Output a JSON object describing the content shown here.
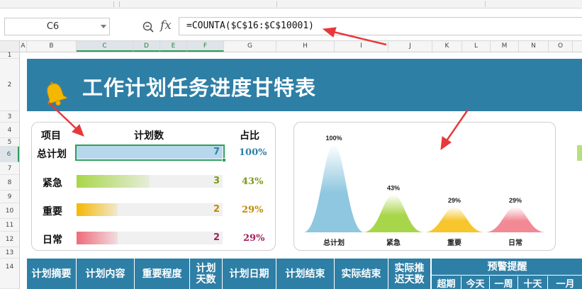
{
  "formula_bar": {
    "cell_ref": "C6",
    "fx_label": "fx",
    "formula": "=COUNTA($C$16:$C$10001)"
  },
  "columns": [
    "A",
    "B",
    "C",
    "D",
    "E",
    "F",
    "G",
    "H",
    "I",
    "J",
    "K",
    "L",
    "M",
    "N",
    "O"
  ],
  "rows": [
    "1",
    "2",
    "3",
    "4",
    "5",
    "6",
    "7",
    "8",
    "9",
    "10",
    "11",
    "12",
    "13",
    "14"
  ],
  "selected": {
    "column": "C",
    "row": "6"
  },
  "banner": {
    "title": "工作计划任务进度甘特表",
    "bg_color": "#2e7fa6",
    "icon": "bell-icon"
  },
  "summary": {
    "headers": {
      "item": "项目",
      "count": "计划数",
      "ratio": "占比"
    },
    "rows": [
      {
        "label": "总计划",
        "count": "7",
        "pct": "100%",
        "fill": 1.0,
        "color": "#b6d8ea",
        "text_color": "#2e7fa6"
      },
      {
        "label": "紧急",
        "count": "3",
        "pct": "43%",
        "fill": 0.5,
        "color": "#a8d64a",
        "text_color": "#7a9a16"
      },
      {
        "label": "重要",
        "count": "2",
        "pct": "29%",
        "fill": 0.28,
        "color": "#f5b800",
        "text_color": "#c08a00"
      },
      {
        "label": "日常",
        "count": "2",
        "pct": "29%",
        "fill": 0.28,
        "color": "#f06a7a",
        "text_color": "#a0205a"
      }
    ]
  },
  "chart_data": {
    "type": "area",
    "categories": [
      "总计划",
      "紧急",
      "重要",
      "日常"
    ],
    "values": [
      100,
      43,
      29,
      29
    ],
    "data_labels": [
      "100%",
      "43%",
      "29%",
      "29%"
    ],
    "colors": [
      "#8ec7df",
      "#a8d64a",
      "#f7c52c",
      "#f28a96"
    ],
    "ylim": [
      0,
      100
    ]
  },
  "table_header": {
    "columns": [
      "计划摘要",
      "计划内容",
      "重要程度",
      "计划天数",
      "计划日期",
      "计划结束",
      "实际结束",
      "实际推迟天数"
    ],
    "warning_group": "预警提醒",
    "warning_sub": [
      "超期",
      "今天",
      "一周",
      "十天",
      "一月"
    ]
  }
}
